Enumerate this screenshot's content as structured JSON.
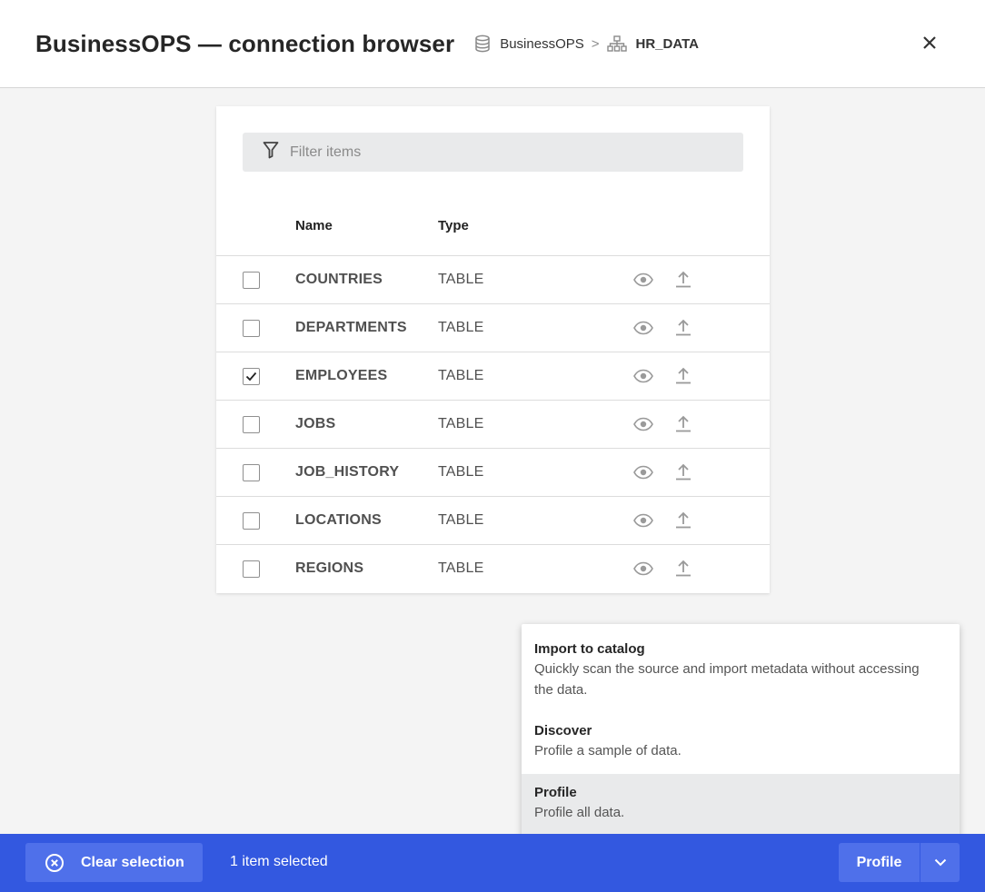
{
  "header": {
    "title": "BusinessOPS — connection browser",
    "breadcrumb": {
      "connection": "BusinessOPS",
      "separator": ">",
      "schema": "HR_DATA"
    }
  },
  "filter": {
    "placeholder": "Filter items"
  },
  "table": {
    "columns": {
      "name": "Name",
      "type": "Type"
    },
    "rows": [
      {
        "name": "COUNTRIES",
        "type": "TABLE",
        "checked": false
      },
      {
        "name": "DEPARTMENTS",
        "type": "TABLE",
        "checked": false
      },
      {
        "name": "EMPLOYEES",
        "type": "TABLE",
        "checked": true
      },
      {
        "name": "JOBS",
        "type": "TABLE",
        "checked": false
      },
      {
        "name": "JOB_HISTORY",
        "type": "TABLE",
        "checked": false
      },
      {
        "name": "LOCATIONS",
        "type": "TABLE",
        "checked": false
      },
      {
        "name": "REGIONS",
        "type": "TABLE",
        "checked": false
      }
    ]
  },
  "menu": {
    "items": [
      {
        "title": "Import to catalog",
        "description": "Quickly scan the source and import metadata without accessing the data."
      },
      {
        "title": "Discover",
        "description": "Profile a sample of data."
      },
      {
        "title": "Profile",
        "description": "Profile all data."
      }
    ]
  },
  "footer": {
    "clear_label": "Clear selection",
    "selection_count": "1 item selected",
    "profile_label": "Profile"
  },
  "colors": {
    "accent": "#3358e0",
    "button": "#4f70ea",
    "menu_highlight": "#e9eaeb"
  }
}
